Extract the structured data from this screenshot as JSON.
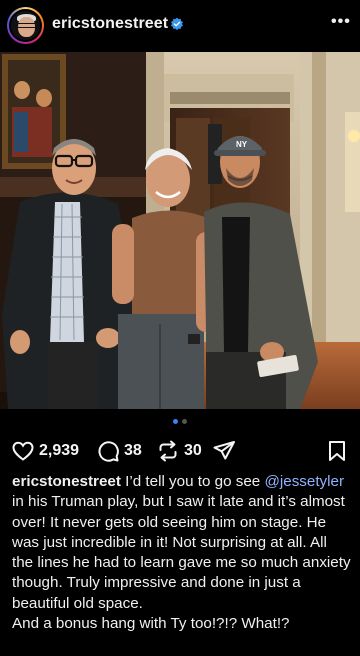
{
  "post": {
    "username": "ericstonestreet",
    "verified": true,
    "more_label": "•••",
    "image_alt": "Three men posing together in an ornate wood-panelled room",
    "carousel": {
      "count": 2,
      "active_index": 0
    }
  },
  "actions": {
    "likes": "2,939",
    "comments": "38",
    "reposts": "30"
  },
  "caption": {
    "username": "ericstonestreet",
    "text_1": "I’d tell you to go see ",
    "mention": "@jessetyler",
    "text_2": " in his Truman play, but I saw it late and it’s almost over! It never gets old seeing him on stage. He was just incredible in it! Not surprising at all. All the lines he had to learn gave me so much anxiety though. Truly impressive and done in just a beautiful old space.",
    "text_3": "And a bonus hang with Ty too!?!? What!?"
  },
  "colors": {
    "background": "#000000",
    "verified": "#3897f0",
    "mention": "#8fb2ff",
    "carousel_active": "#3b82f6"
  }
}
